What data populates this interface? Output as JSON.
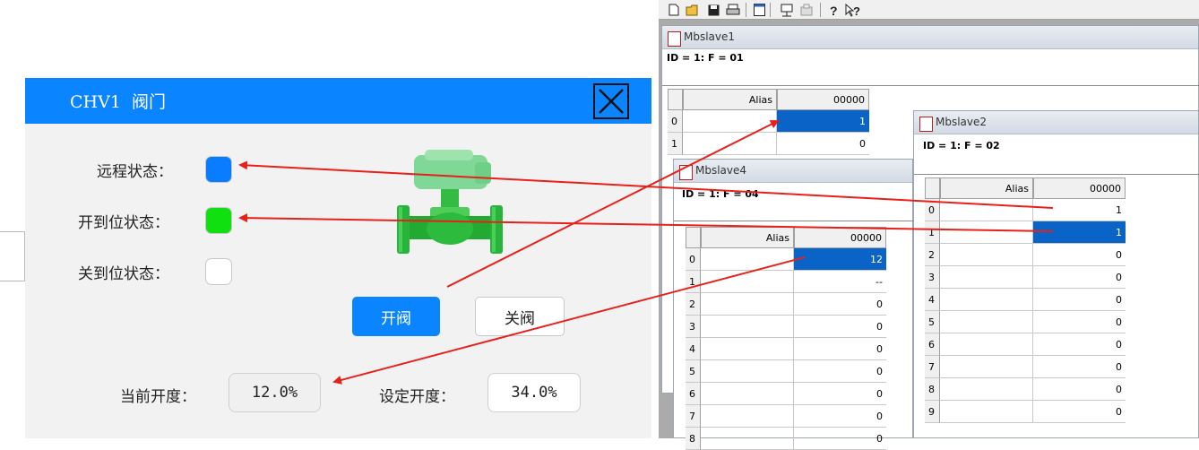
{
  "dialog": {
    "title": "CHV1  阀门",
    "status_rows": [
      {
        "label": "远程状态：",
        "color": "#0a7cff"
      },
      {
        "label": "开到位状态：",
        "color": "#10e010"
      },
      {
        "label": "关到位状态：",
        "color": "#ffffff"
      }
    ],
    "open_button": "开阀",
    "close_button": "关阀",
    "current_label": "当前开度：",
    "current_value": "12.0%",
    "setpoint_label": "设定开度：",
    "setpoint_value": "34.0%",
    "accent_color": "#0a84ff"
  },
  "toolbar": {
    "icons": [
      "new-icon",
      "open-folder-icon",
      "save-icon",
      "print-icon",
      "window-icon",
      "connect-icon",
      "disconnect-icon",
      "help-icon",
      "context-help-icon"
    ]
  },
  "mbslave1": {
    "title": "Mbslave1",
    "info": "ID = 1: F = 01",
    "col_alias": "Alias",
    "col_addr": "00000",
    "rows": [
      {
        "idx": "0",
        "alias": "",
        "value": "1",
        "selected": true
      },
      {
        "idx": "1",
        "alias": "",
        "value": "0",
        "selected": false
      }
    ]
  },
  "mbslave4": {
    "title": "Mbslave4",
    "info": "ID = 1: F = 04",
    "col_alias": "Alias",
    "col_addr": "00000",
    "rows": [
      {
        "idx": "0",
        "alias": "",
        "value": "12",
        "selected": true
      },
      {
        "idx": "1",
        "alias": "",
        "value": "--",
        "selected": false
      },
      {
        "idx": "2",
        "alias": "",
        "value": "0",
        "selected": false
      },
      {
        "idx": "3",
        "alias": "",
        "value": "0",
        "selected": false
      },
      {
        "idx": "4",
        "alias": "",
        "value": "0",
        "selected": false
      },
      {
        "idx": "5",
        "alias": "",
        "value": "0",
        "selected": false
      },
      {
        "idx": "6",
        "alias": "",
        "value": "0",
        "selected": false
      },
      {
        "idx": "7",
        "alias": "",
        "value": "0",
        "selected": false
      },
      {
        "idx": "8",
        "alias": "",
        "value": "0",
        "selected": false
      }
    ]
  },
  "mbslave2": {
    "title": "Mbslave2",
    "info": "ID = 1: F = 02",
    "col_alias": "Alias",
    "col_addr": "00000",
    "rows": [
      {
        "idx": "0",
        "alias": "",
        "value": "1",
        "selected": false
      },
      {
        "idx": "1",
        "alias": "",
        "value": "1",
        "selected": true
      },
      {
        "idx": "2",
        "alias": "",
        "value": "0",
        "selected": false
      },
      {
        "idx": "3",
        "alias": "",
        "value": "0",
        "selected": false
      },
      {
        "idx": "4",
        "alias": "",
        "value": "0",
        "selected": false
      },
      {
        "idx": "5",
        "alias": "",
        "value": "0",
        "selected": false
      },
      {
        "idx": "6",
        "alias": "",
        "value": "0",
        "selected": false
      },
      {
        "idx": "7",
        "alias": "",
        "value": "0",
        "selected": false
      },
      {
        "idx": "8",
        "alias": "",
        "value": "0",
        "selected": false
      },
      {
        "idx": "9",
        "alias": "",
        "value": "0",
        "selected": false
      }
    ]
  },
  "annotation_arrow_color": "#e8201a"
}
